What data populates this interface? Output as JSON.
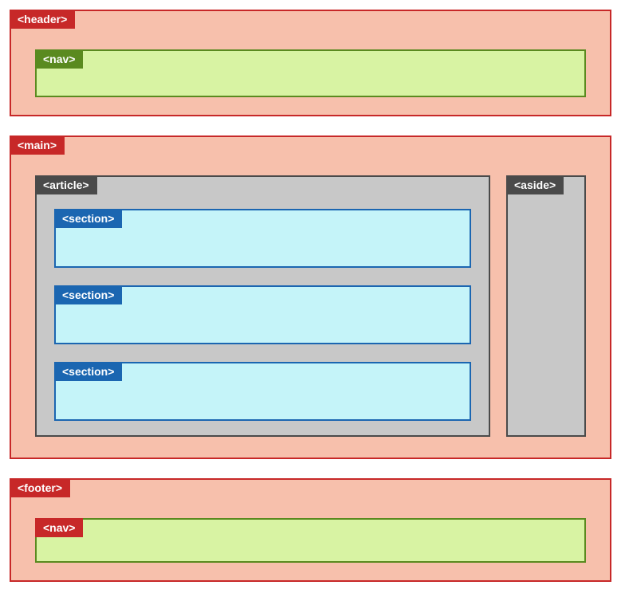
{
  "labels": {
    "header": "<header>",
    "nav": "<nav>",
    "main": "<main>",
    "article": "<article>",
    "aside": "<aside>",
    "section": "<section>",
    "footer": "<footer>"
  },
  "structure": {
    "header": {
      "children": [
        "nav"
      ]
    },
    "main": {
      "children": [
        "article",
        "aside"
      ]
    },
    "article": {
      "sections": 3
    },
    "footer": {
      "children": [
        "nav"
      ]
    }
  },
  "colors": {
    "header_bg": "#f7c0ac",
    "header_border": "#c72828",
    "nav_bg": "#d8f3a3",
    "nav_border": "#5a8a1f",
    "article_bg": "#c8c8c8",
    "article_border": "#4a4a4a",
    "section_bg": "#c5f4f9",
    "section_border": "#1b66b1"
  }
}
